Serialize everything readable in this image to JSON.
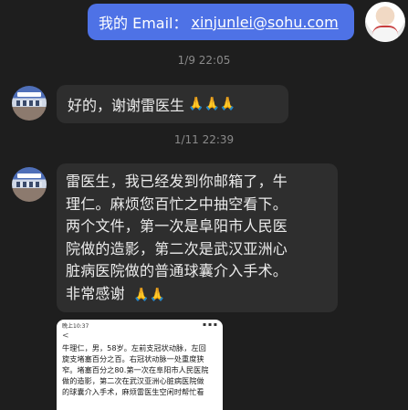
{
  "outgoing": {
    "prefix": "我的 Email：",
    "email": "xinjunlei@sohu.com"
  },
  "timestamps": [
    "1/9 22:05",
    "1/11 22:39"
  ],
  "messages": [
    {
      "text": "好的，谢谢雷医生",
      "emoji": "🙏🙏🙏"
    },
    {
      "lines": [
        "雷医生，我已经发到你邮箱了，牛",
        "理仁。麻烦您百忙之中抽空看下。",
        "两个文件，第一次是阜阳市人民医",
        "院做的造影，第二次是武汉亚洲心",
        "脏病医院做的普通球囊介入手术。"
      ],
      "last_line": "非常感谢",
      "emoji": "🙏🙏"
    }
  ],
  "attachment": {
    "status_time": "晚上10:37",
    "status_right": "▪ ▪ ▪",
    "back_glyph": "<",
    "lines": [
      "牛理仁，男，58岁。左前支冠状动脉，左回",
      "旋支堵塞百分之百。右冠状动脉一处重度狭",
      "窄。堵塞百分之80.第一次在阜阳市人民医院",
      "做的造影，第二次在武汉亚洲心脏病医院做",
      "的球囊介入手术，麻烦雷医生空闲时帮忙看"
    ]
  },
  "colors": {
    "background": "#1e1e1e",
    "outgoing_bubble": "#4e72e6",
    "incoming_bubble": "#2e2e2e",
    "timestamp": "#8a8a8a"
  }
}
